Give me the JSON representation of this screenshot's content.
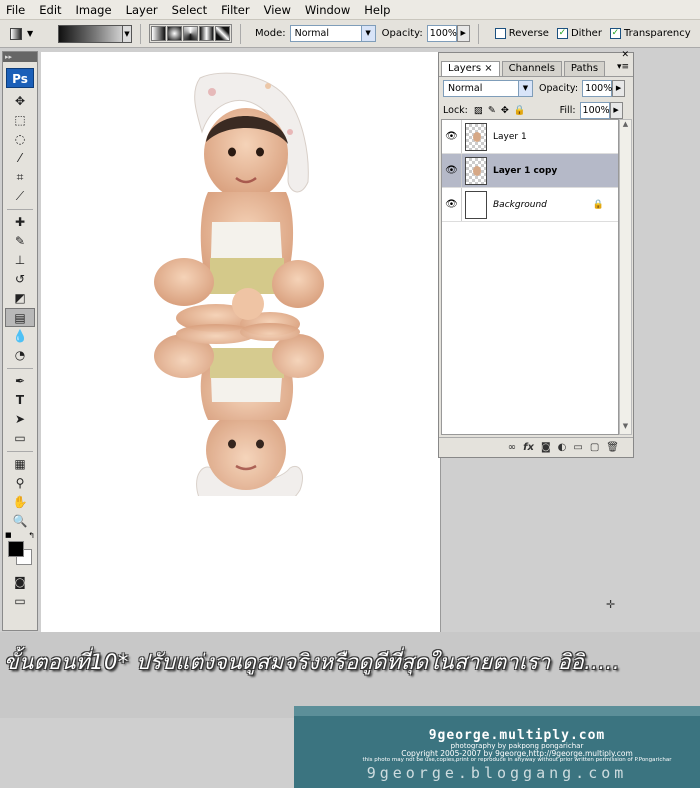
{
  "menu": [
    "File",
    "Edit",
    "Image",
    "Layer",
    "Select",
    "Filter",
    "View",
    "Window",
    "Help"
  ],
  "options": {
    "mode_label": "Mode:",
    "mode_value": "Normal",
    "opacity_label": "Opacity:",
    "opacity_value": "100%",
    "reverse_label": "Reverse",
    "reverse_checked": false,
    "dither_label": "Dither",
    "dither_checked": true,
    "transparency_label": "Transparency",
    "transparency_checked": true
  },
  "tools": {
    "logo": "Ps",
    "icons": [
      "move-tool-icon",
      "marquee-tool-icon",
      "lasso-tool-icon",
      "magic-wand-icon",
      "crop-tool-icon",
      "slice-tool-icon",
      "healing-brush-icon",
      "brush-tool-icon",
      "clone-stamp-icon",
      "history-brush-icon",
      "eraser-tool-icon",
      "gradient-tool-icon",
      "blur-tool-icon",
      "dodge-tool-icon",
      "pen-tool-icon",
      "type-tool-icon",
      "path-selection-icon",
      "shape-tool-icon",
      "notes-tool-icon",
      "eyedropper-icon",
      "hand-tool-icon",
      "zoom-tool-icon"
    ],
    "active": "gradient-tool-icon",
    "foreground_color": "#000000",
    "background_color": "#ffffff"
  },
  "layers_panel": {
    "tabs": [
      "Layers",
      "Channels",
      "Paths"
    ],
    "active_tab": "Layers",
    "blend_mode": "Normal",
    "opacity_label": "Opacity:",
    "opacity_value": "100%",
    "lock_label": "Lock:",
    "fill_label": "Fill:",
    "fill_value": "100%",
    "layers": [
      {
        "name": "Layer 1",
        "visible": true,
        "selected": false,
        "locked": false
      },
      {
        "name": "Layer 1 copy",
        "visible": true,
        "selected": true,
        "locked": false
      },
      {
        "name": "Background",
        "visible": true,
        "selected": false,
        "locked": true
      }
    ]
  },
  "caption": "ขั้นตอนที่10* ปรับแต่งจนดูสมจริงหรือดูดีที่สุดในสายตาเรา อิอิ.....",
  "watermark": {
    "site": "9george.multiply.com",
    "photo_credit": "photography by pakpong pongarichar",
    "copyright": "Copyright 2005-2007 by 9george,http://9george.multiply.com",
    "notice": "this photo may not be use,copies,print or reproduce in anyway without prior written permission of P.Pongarichar",
    "blog": "9george.bloggang.com"
  },
  "colors": {
    "watermark_bg": "#3b7480",
    "selected_layer": "#b5b9c8",
    "ps_logo": "#1b5fb8"
  }
}
